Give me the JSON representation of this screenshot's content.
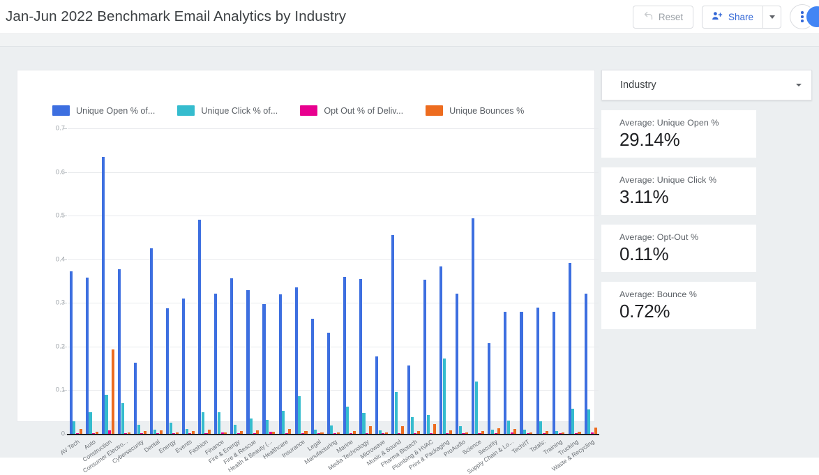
{
  "header": {
    "title": "Jan-Jun 2022 Benchmark Email Analytics by Industry",
    "reset_label": "Reset",
    "share_label": "Share"
  },
  "panel": {
    "filter": {
      "label": "Industry"
    },
    "stats": [
      {
        "label": "Average: Unique Open %",
        "value": "29.14%"
      },
      {
        "label": "Average: Unique Click %",
        "value": "3.11%"
      },
      {
        "label": "Average: Opt-Out %",
        "value": "0.11%"
      },
      {
        "label": "Average: Bounce %",
        "value": "0.72%"
      }
    ]
  },
  "colors": {
    "series_open": "#3d6fe0",
    "series_click": "#35bcce",
    "series_optout": "#e8008f",
    "series_bounce": "#ed6c1f",
    "accent": "#3367d6",
    "canvas_bg": "#eceff1"
  },
  "chart_data": {
    "type": "bar",
    "title": "",
    "xlabel": "",
    "ylabel": "",
    "ylim": [
      0,
      0.7
    ],
    "yticks": [
      "0",
      "0.1",
      "0.2",
      "0.3",
      "0.4",
      "0.5",
      "0.6",
      "0.7"
    ],
    "ytick_values": [
      0,
      0.1,
      0.2,
      0.3,
      0.4,
      0.5,
      0.6,
      0.7
    ],
    "grid": true,
    "legend_position": "top-left",
    "categories": [
      "AV Tech",
      "Auto",
      "Construction",
      "Consumer Electro...",
      "Cybersecurity",
      "Dental",
      "Energy",
      "Events",
      "Fashion",
      "Finance",
      "Fire & Energy",
      "Fire & Rescue",
      "Health & Beauty (...",
      "Healthcare",
      "Insurance",
      "Legal",
      "Manufacturing",
      "Marine",
      "Media Technology",
      "Microwave",
      "Music & Sound",
      "Pharma Biotech",
      "Plumbing & HVAC",
      "Print & Packaging",
      "ProAudio",
      "Science",
      "Security",
      "Supply Chain & Lo...",
      "Tech/IT",
      "Totals:",
      "Training",
      "Trucking",
      "Waste & Recycling"
    ],
    "series": [
      {
        "name": "Unique Open % of...",
        "color": "#3d6fe0",
        "values": [
          0.372,
          0.358,
          0.634,
          0.377,
          0.163,
          0.425,
          0.288,
          0.31,
          0.491,
          0.322,
          0.356,
          0.329,
          0.298,
          0.32,
          0.336,
          0.263,
          0.232,
          0.359,
          0.355,
          0.178,
          0.456,
          0.157,
          0.354,
          0.384,
          0.321,
          0.494,
          0.207,
          0.28,
          0.28,
          0.29,
          0.279,
          0.391,
          0.321
        ]
      },
      {
        "name": "Unique Click % of...",
        "color": "#35bcce",
        "values": [
          0.029,
          0.049,
          0.089,
          0.07,
          0.021,
          0.01,
          0.026,
          0.011,
          0.049,
          0.049,
          0.021,
          0.035,
          0.032,
          0.053,
          0.086,
          0.01,
          0.02,
          0.062,
          0.048,
          0.008,
          0.096,
          0.038,
          0.043,
          0.172,
          0.017,
          0.12,
          0.01,
          0.03,
          0.009,
          0.028,
          0.006,
          0.057,
          0.056
        ]
      },
      {
        "name": "Opt Out % of Deliv...",
        "color": "#e8008f",
        "values": [
          0.001,
          0.001,
          0.008,
          0.002,
          0.001,
          0.001,
          0.001,
          0.001,
          0.001,
          0.004,
          0.001,
          0.001,
          0.005,
          0.001,
          0.002,
          0.001,
          0.001,
          0.001,
          0.001,
          0.001,
          0.002,
          0.001,
          0.002,
          0.002,
          0.001,
          0.001,
          0.001,
          0.003,
          0.001,
          0.002,
          0.001,
          0.001,
          0.003
        ]
      },
      {
        "name": "Unique Bounces %",
        "color": "#ed6c1f",
        "values": [
          0.011,
          0.005,
          0.193,
          0.004,
          0.007,
          0.008,
          0.003,
          0.006,
          0.009,
          0.004,
          0.006,
          0.008,
          0.005,
          0.011,
          0.006,
          0.004,
          0.004,
          0.006,
          0.017,
          0.004,
          0.018,
          0.006,
          0.022,
          0.008,
          0.004,
          0.007,
          0.013,
          0.011,
          0.004,
          0.006,
          0.004,
          0.005,
          0.014
        ]
      }
    ]
  }
}
